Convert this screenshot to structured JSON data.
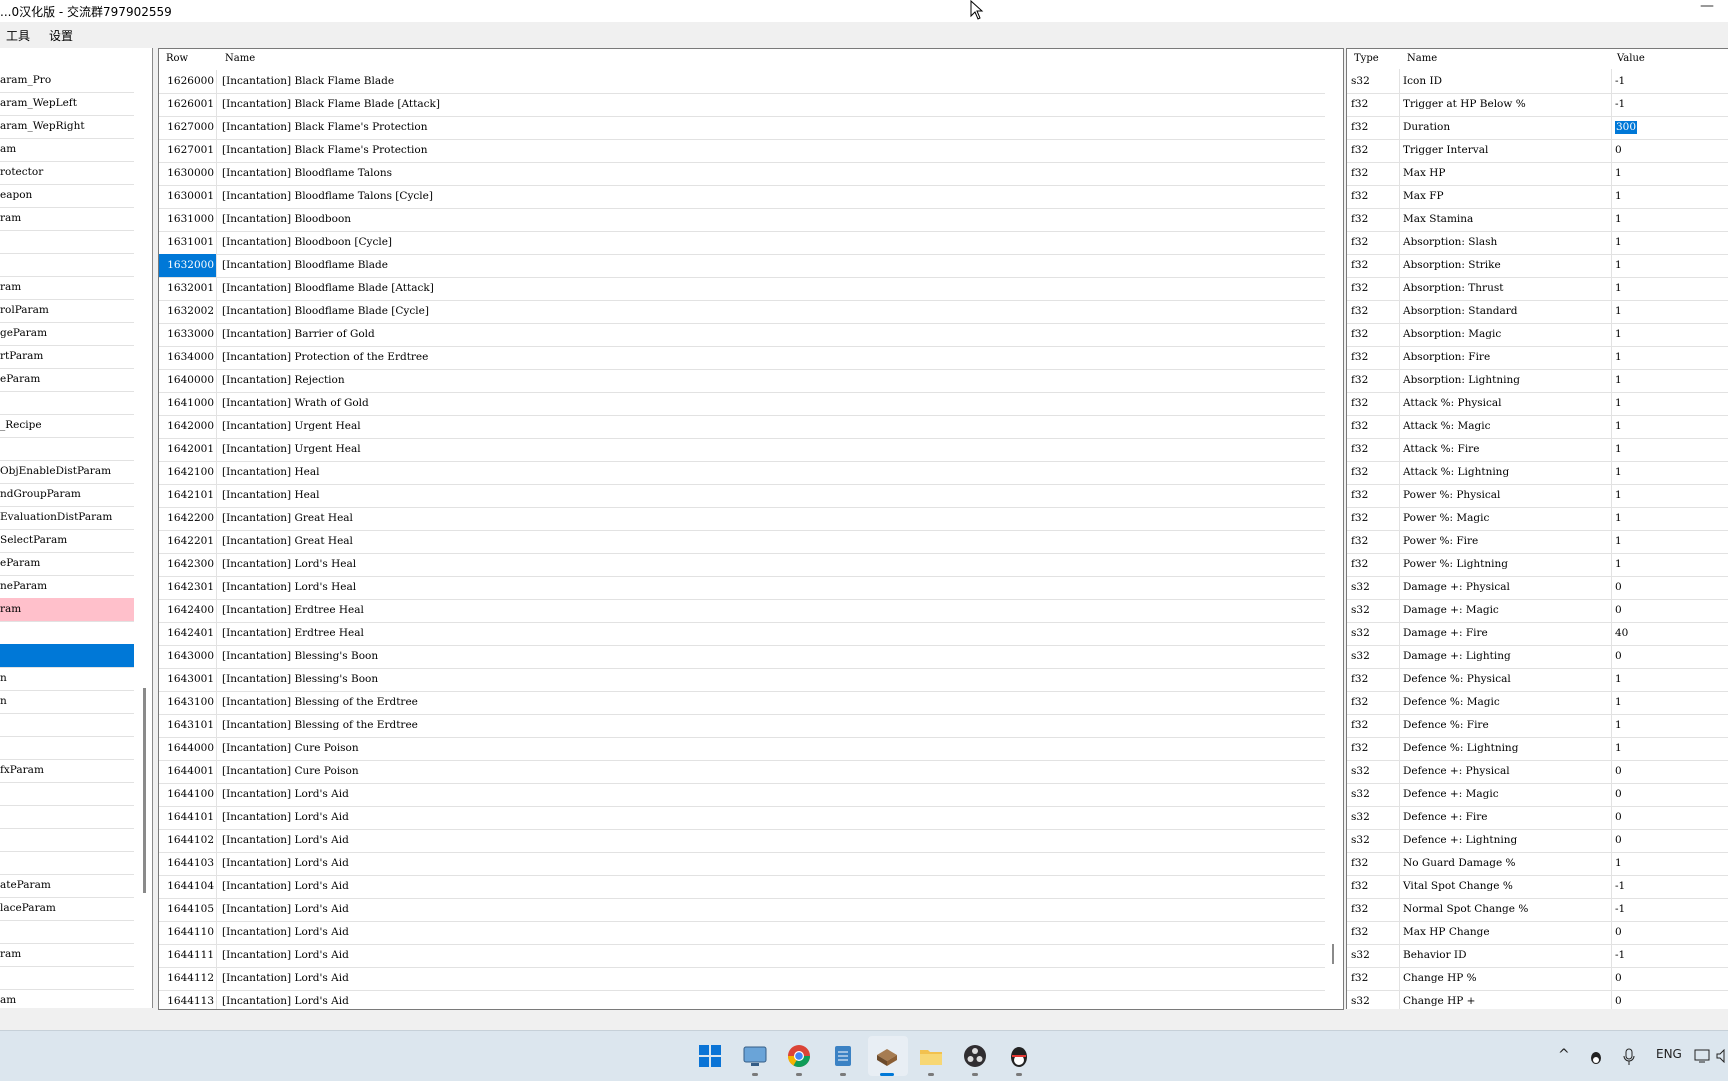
{
  "window": {
    "title": "...0汉化版 - 交流群797902559"
  },
  "menu": [
    "工具",
    "设置"
  ],
  "left_list": [
    {
      "label": "aram_Pro"
    },
    {
      "label": "aram_WepLeft"
    },
    {
      "label": "aram_WepRight"
    },
    {
      "label": "am"
    },
    {
      "label": "rotector"
    },
    {
      "label": "eapon"
    },
    {
      "label": "ram"
    },
    {
      "label": ""
    },
    {
      "label": ""
    },
    {
      "label": "ram"
    },
    {
      "label": "rolParam"
    },
    {
      "label": "geParam"
    },
    {
      "label": "rtParam"
    },
    {
      "label": "eParam"
    },
    {
      "label": ""
    },
    {
      "label": "_Recipe"
    },
    {
      "label": ""
    },
    {
      "label": "ObjEnableDistParam"
    },
    {
      "label": "ndGroupParam"
    },
    {
      "label": "EvaluationDistParam"
    },
    {
      "label": "SelectParam"
    },
    {
      "label": "eParam"
    },
    {
      "label": "neParam"
    },
    {
      "label": "ram",
      "state": "pink"
    },
    {
      "label": ""
    },
    {
      "label": "",
      "state": "selected"
    },
    {
      "label": "n"
    },
    {
      "label": "n"
    },
    {
      "label": ""
    },
    {
      "label": ""
    },
    {
      "label": "fxParam"
    },
    {
      "label": ""
    },
    {
      "label": ""
    },
    {
      "label": ""
    },
    {
      "label": ""
    },
    {
      "label": "ateParam"
    },
    {
      "label": "laceParam"
    },
    {
      "label": ""
    },
    {
      "label": "ram"
    },
    {
      "label": ""
    },
    {
      "label": "am"
    }
  ],
  "rows_table": {
    "headers": {
      "row": "Row",
      "name": "Name"
    },
    "selected_index": 8,
    "rows": [
      [
        "1626000",
        "[Incantation] Black Flame Blade"
      ],
      [
        "1626001",
        "[Incantation] Black Flame Blade [Attack]"
      ],
      [
        "1627000",
        "[Incantation] Black Flame's Protection"
      ],
      [
        "1627001",
        "[Incantation] Black Flame's Protection"
      ],
      [
        "1630000",
        "[Incantation] Bloodflame Talons"
      ],
      [
        "1630001",
        "[Incantation] Bloodflame Talons [Cycle]"
      ],
      [
        "1631000",
        "[Incantation] Bloodboon"
      ],
      [
        "1631001",
        "[Incantation] Bloodboon [Cycle]"
      ],
      [
        "1632000",
        "[Incantation] Bloodflame Blade"
      ],
      [
        "1632001",
        "[Incantation] Bloodflame Blade [Attack]"
      ],
      [
        "1632002",
        "[Incantation] Bloodflame Blade [Cycle]"
      ],
      [
        "1633000",
        "[Incantation] Barrier of Gold"
      ],
      [
        "1634000",
        "[Incantation] Protection of the Erdtree"
      ],
      [
        "1640000",
        "[Incantation] Rejection"
      ],
      [
        "1641000",
        "[Incantation] Wrath of Gold"
      ],
      [
        "1642000",
        "[Incantation] Urgent Heal"
      ],
      [
        "1642001",
        "[Incantation] Urgent Heal"
      ],
      [
        "1642100",
        "[Incantation] Heal"
      ],
      [
        "1642101",
        "[Incantation] Heal"
      ],
      [
        "1642200",
        "[Incantation] Great Heal"
      ],
      [
        "1642201",
        "[Incantation] Great Heal"
      ],
      [
        "1642300",
        "[Incantation] Lord's Heal"
      ],
      [
        "1642301",
        "[Incantation] Lord's Heal"
      ],
      [
        "1642400",
        "[Incantation] Erdtree Heal"
      ],
      [
        "1642401",
        "[Incantation] Erdtree Heal"
      ],
      [
        "1643000",
        "[Incantation] Blessing's Boon"
      ],
      [
        "1643001",
        "[Incantation] Blessing's Boon"
      ],
      [
        "1643100",
        "[Incantation] Blessing of the Erdtree"
      ],
      [
        "1643101",
        "[Incantation] Blessing of the Erdtree"
      ],
      [
        "1644000",
        "[Incantation] Cure Poison"
      ],
      [
        "1644001",
        "[Incantation] Cure Poison"
      ],
      [
        "1644100",
        "[Incantation] Lord's Aid"
      ],
      [
        "1644101",
        "[Incantation] Lord's Aid"
      ],
      [
        "1644102",
        "[Incantation] Lord's Aid"
      ],
      [
        "1644103",
        "[Incantation] Lord's Aid"
      ],
      [
        "1644104",
        "[Incantation] Lord's Aid"
      ],
      [
        "1644105",
        "[Incantation] Lord's Aid"
      ],
      [
        "1644110",
        "[Incantation] Lord's Aid"
      ],
      [
        "1644111",
        "[Incantation] Lord's Aid"
      ],
      [
        "1644112",
        "[Incantation] Lord's Aid"
      ],
      [
        "1644113",
        "[Incantation] Lord's Aid"
      ]
    ]
  },
  "fields_table": {
    "headers": {
      "type": "Type",
      "name": "Name",
      "value": "Value"
    },
    "highlighted_index": 2,
    "rows": [
      [
        "s32",
        "Icon ID",
        "-1"
      ],
      [
        "f32",
        "Trigger at HP Below %",
        "-1"
      ],
      [
        "f32",
        "Duration",
        "300"
      ],
      [
        "f32",
        "Trigger Interval",
        "0"
      ],
      [
        "f32",
        "Max HP",
        "1"
      ],
      [
        "f32",
        "Max FP",
        "1"
      ],
      [
        "f32",
        "Max Stamina",
        "1"
      ],
      [
        "f32",
        "Absorption: Slash",
        "1"
      ],
      [
        "f32",
        "Absorption: Strike",
        "1"
      ],
      [
        "f32",
        "Absorption: Thrust",
        "1"
      ],
      [
        "f32",
        "Absorption: Standard",
        "1"
      ],
      [
        "f32",
        "Absorption: Magic",
        "1"
      ],
      [
        "f32",
        "Absorption: Fire",
        "1"
      ],
      [
        "f32",
        "Absorption: Lightning",
        "1"
      ],
      [
        "f32",
        "Attack %: Physical",
        "1"
      ],
      [
        "f32",
        "Attack %: Magic",
        "1"
      ],
      [
        "f32",
        "Attack %: Fire",
        "1"
      ],
      [
        "f32",
        "Attack %: Lightning",
        "1"
      ],
      [
        "f32",
        "Power %: Physical",
        "1"
      ],
      [
        "f32",
        "Power %: Magic",
        "1"
      ],
      [
        "f32",
        "Power %: Fire",
        "1"
      ],
      [
        "f32",
        "Power %: Lightning",
        "1"
      ],
      [
        "s32",
        "Damage +: Physical",
        "0"
      ],
      [
        "s32",
        "Damage +: Magic",
        "0"
      ],
      [
        "s32",
        "Damage +: Fire",
        "40"
      ],
      [
        "s32",
        "Damage +: Lighting",
        "0"
      ],
      [
        "f32",
        "Defence %: Physical",
        "1"
      ],
      [
        "f32",
        "Defence %: Magic",
        "1"
      ],
      [
        "f32",
        "Defence %: Fire",
        "1"
      ],
      [
        "f32",
        "Defence %: Lightning",
        "1"
      ],
      [
        "s32",
        "Defence +: Physical",
        "0"
      ],
      [
        "s32",
        "Defence +: Magic",
        "0"
      ],
      [
        "s32",
        "Defence +: Fire",
        "0"
      ],
      [
        "s32",
        "Defence +: Lightning",
        "0"
      ],
      [
        "f32",
        "No Guard Damage %",
        "1"
      ],
      [
        "f32",
        "Vital Spot Change %",
        "-1"
      ],
      [
        "f32",
        "Normal Spot Change %",
        "-1"
      ],
      [
        "f32",
        "Max HP Change",
        "0"
      ],
      [
        "s32",
        "Behavior ID",
        "-1"
      ],
      [
        "f32",
        "Change HP %",
        "0"
      ],
      [
        "s32",
        "Change HP +",
        "0"
      ]
    ]
  },
  "taskbar": {
    "apps": [
      "windows-start",
      "remote-desktop",
      "chrome",
      "notepad",
      "param-editor",
      "file-explorer",
      "obs",
      "qq"
    ],
    "tray": {
      "language": "ENG"
    }
  },
  "colors": {
    "selection": "#0078d7",
    "pink_row": "#ffc0cb"
  }
}
